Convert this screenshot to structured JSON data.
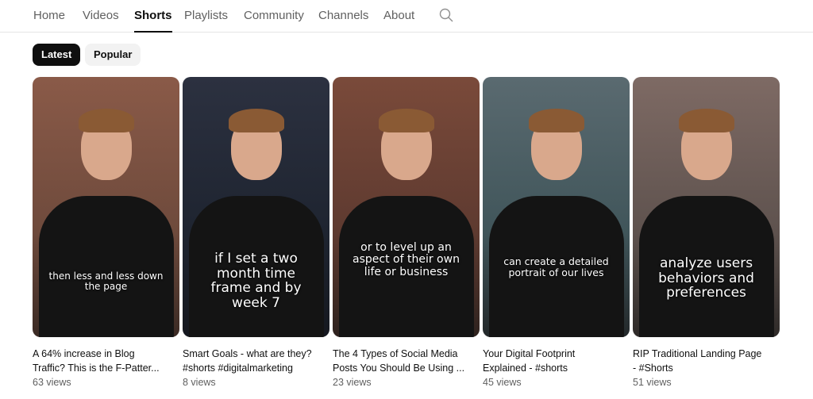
{
  "tabs": [
    {
      "label": "Home"
    },
    {
      "label": "Videos"
    },
    {
      "label": "Shorts",
      "active": true
    },
    {
      "label": "Playlists"
    },
    {
      "label": "Community"
    },
    {
      "label": "Channels"
    },
    {
      "label": "About"
    }
  ],
  "search_icon": "search-icon",
  "chips": [
    {
      "label": "Latest",
      "selected": true
    },
    {
      "label": "Popular",
      "selected": false
    }
  ],
  "shorts": [
    {
      "caption": "then less and less down the page",
      "title_line1": "A 64% increase in Blog",
      "title_line2": "Traffic? This is the F-Patter...",
      "views": "63 views"
    },
    {
      "caption": "if I set a two month time frame and by week 7",
      "title_line1": "Smart Goals - what are they?",
      "title_line2": "#shorts #digitalmarketing",
      "views": "8 views"
    },
    {
      "caption": "or to level up an aspect of their own life or business",
      "title_line1": "The 4 Types of Social Media",
      "title_line2": "Posts You Should Be Using ...",
      "views": "23 views"
    },
    {
      "caption": "can create a detailed portrait of our lives",
      "title_line1": "Your Digital Footprint",
      "title_line2": "Explained - #shorts",
      "views": "45 views"
    },
    {
      "caption": "analyze users behaviors and preferences",
      "title_line1": "RIP Traditional Landing Page",
      "title_line2": "- #Shorts",
      "views": "51 views"
    }
  ]
}
